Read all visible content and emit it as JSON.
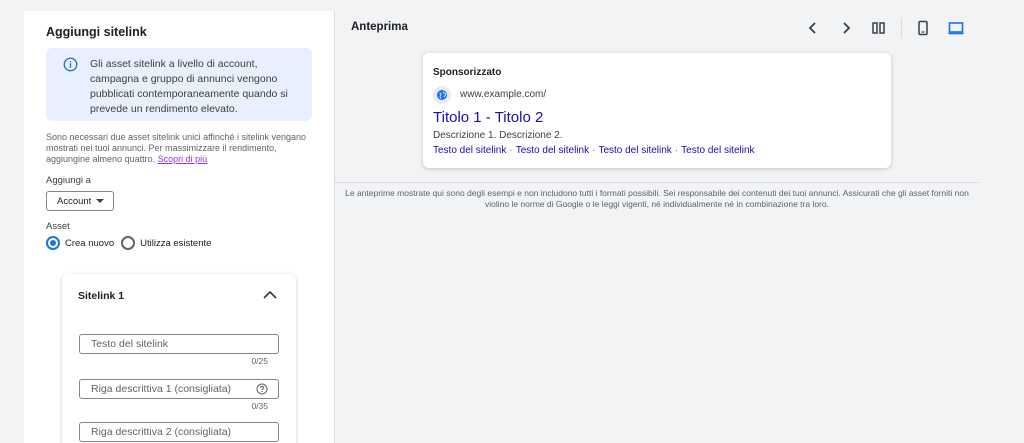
{
  "left": {
    "title": "Aggiungi sitelink",
    "info": "Gli asset sitelink a livello di account, campagna e gruppo di annunci vengono pubblicati contemporaneamente quando si prevede un rendimento elevato.",
    "help_text": "Sono necessari due asset sitelink unici affinché i sitelink vengano mostrati nei tuoi annunci. Per massimizzare il rendimento, aggiungine almeno quattro.",
    "help_link": "Scopri di più",
    "add_to_label": "Aggiungi a",
    "add_to_value": "Account",
    "asset_label": "Asset",
    "radio_new": "Crea nuovo",
    "radio_existing": "Utilizza esistente",
    "sitelink": {
      "title": "Sitelink 1",
      "field1_placeholder": "Testo del sitelink",
      "field1_count": "0/25",
      "field2_placeholder": "Riga descrittiva 1 (consigliata)",
      "field2_count": "0/35",
      "field3_placeholder": "Riga descrittiva 2 (consigliata)"
    }
  },
  "right": {
    "title": "Anteprima",
    "icons": [
      "chevron-left-icon",
      "chevron-right-icon",
      "columns-icon",
      "mobile-icon",
      "desktop-icon"
    ],
    "ad": {
      "sponsored": "Sponsorizzato",
      "url": "www.example.com/",
      "headline": "Titolo 1 - Titolo 2",
      "description": "Descrizione 1. Descrizione 2.",
      "sitelinks": [
        "Testo del sitelink",
        "Testo del sitelink",
        "Testo del sitelink",
        "Testo del sitelink"
      ]
    },
    "disclaimer": "Le anteprime mostrate qui sono degli esempi e non includono tutti i formati possibili. Sei responsabile dei contenuti dei tuoi annunci. Assicurati che gli asset forniti non violino le norme di Google o le leggi vigenti, né individualmente né in combinazione tra loro."
  },
  "colors": {
    "accent": "#1a73e8",
    "link": "#1a0dab",
    "info_bg": "#e8f0fe"
  }
}
